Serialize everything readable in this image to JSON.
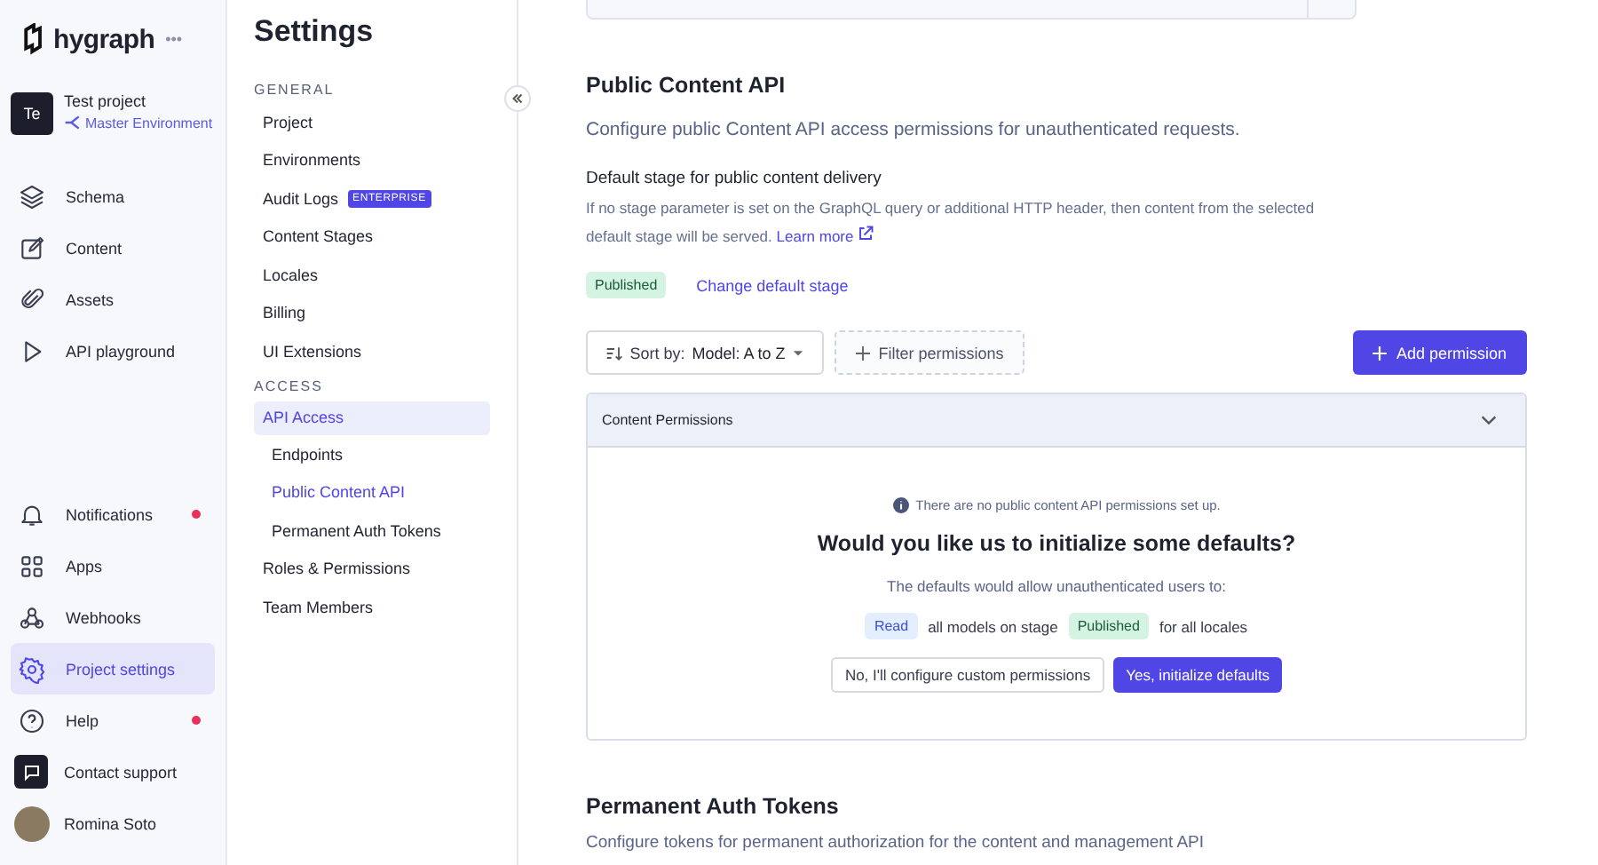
{
  "brand": {
    "name": "hygraph",
    "menu": "•••"
  },
  "project": {
    "initials": "Te",
    "name": "Test project",
    "environment": "Master Environment"
  },
  "nav": [
    {
      "kind": "schema",
      "label": "Schema",
      "selected": false
    },
    {
      "kind": "content",
      "label": "Content",
      "selected": false
    },
    {
      "kind": "assets",
      "label": "Assets",
      "selected": false
    },
    {
      "kind": "playground",
      "label": "API playground",
      "selected": false
    }
  ],
  "nav_bottom": [
    {
      "kind": "bell",
      "label": "Notifications",
      "selected": false,
      "alert": true
    },
    {
      "kind": "apps",
      "label": "Apps",
      "selected": false,
      "alert": false
    },
    {
      "kind": "webhooks",
      "label": "Webhooks",
      "selected": false,
      "alert": false
    },
    {
      "kind": "gear",
      "label": "Project settings",
      "selected": true,
      "alert": false
    },
    {
      "kind": "help",
      "label": "Help",
      "selected": false,
      "alert": true
    },
    {
      "kind": "chat",
      "label": "Contact support",
      "selected": false,
      "alert": false
    },
    {
      "kind": "user",
      "label": "Romina Soto",
      "selected": false,
      "alert": false
    }
  ],
  "settings": {
    "title": "Settings",
    "groups": [
      {
        "label": "GENERAL",
        "items": [
          {
            "label": "Project",
            "selected": false
          },
          {
            "label": "Environments",
            "selected": false
          },
          {
            "label": "Audit Logs",
            "badge": "ENTERPRISE",
            "selected": false
          },
          {
            "label": "Content Stages",
            "selected": false
          },
          {
            "label": "Locales",
            "selected": false
          },
          {
            "label": "Billing",
            "selected": false
          },
          {
            "label": "UI Extensions",
            "selected": false
          }
        ]
      },
      {
        "label": "ACCESS",
        "items": [
          {
            "label": "API Access",
            "selected": true,
            "children": [
              {
                "label": "Endpoints",
                "selected": false
              },
              {
                "label": "Public Content API",
                "selected": true
              },
              {
                "label": "Permanent Auth Tokens",
                "selected": false
              }
            ]
          },
          {
            "label": "Roles & Permissions",
            "selected": false
          },
          {
            "label": "Team Members",
            "selected": false
          }
        ]
      }
    ]
  },
  "public_api": {
    "title": "Public Content API",
    "description": "Configure public Content API access permissions for unauthenticated requests.",
    "stage_title": "Default stage for public content delivery",
    "stage_help": "If no stage parameter is set on the GraphQL query or additional HTTP header, then content from the selected default stage will be served.",
    "learn_more": "Learn more",
    "stage": "Published",
    "change_stage": "Change default stage",
    "sort": {
      "label": "Sort by:",
      "value": "Model: A to Z"
    },
    "filter": "Filter permissions",
    "add": "Add permission"
  },
  "permissions_panel": {
    "title": "Content Permissions",
    "expanded": true,
    "notice": "There are no public content API permissions set up.",
    "question": "Would you like us to initialize some defaults?",
    "explain": "The defaults would allow unauthenticated users to:",
    "rule": {
      "action": "Read",
      "middle": "all models on stage",
      "stage": "Published",
      "end": "for all locales"
    },
    "decline": "No, I'll configure custom permissions",
    "accept": "Yes, initialize defaults"
  },
  "tokens": {
    "title": "Permanent Auth Tokens",
    "description": "Configure tokens for permanent authorization for the content and management API"
  }
}
